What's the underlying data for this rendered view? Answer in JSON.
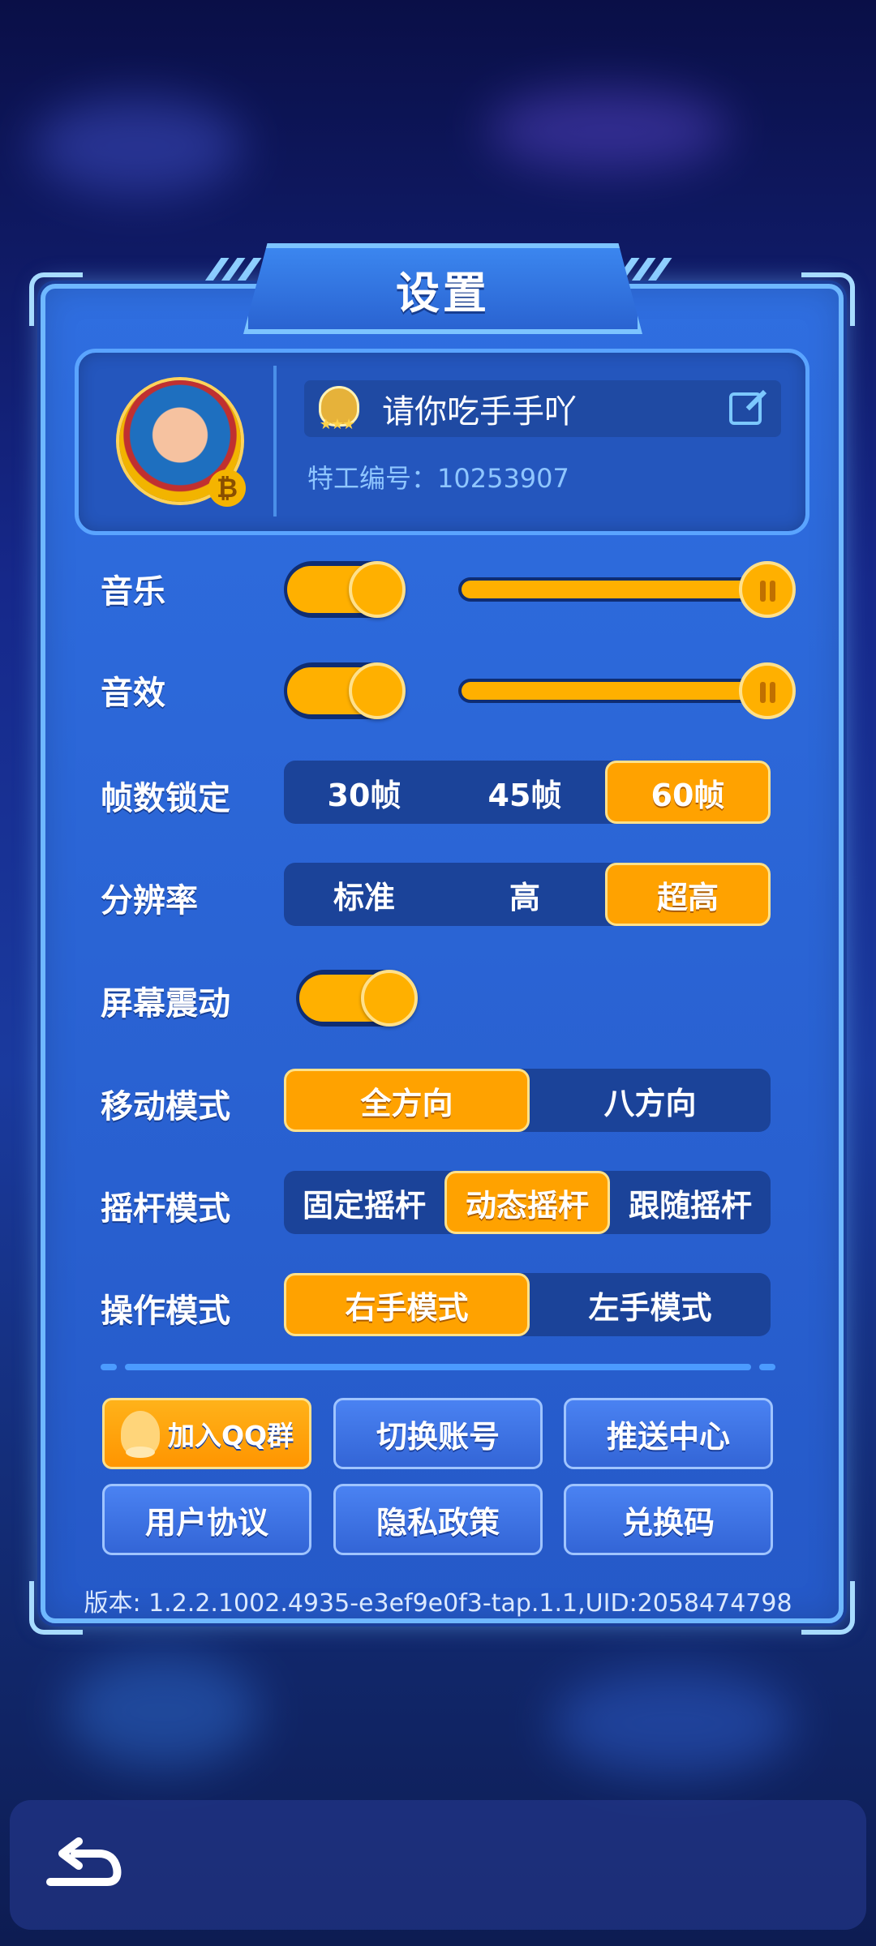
{
  "title": "设置",
  "profile": {
    "name": "请你吃手手吖",
    "agent_id": "特工编号：10253907"
  },
  "settings": {
    "music": {
      "label": "音乐",
      "enabled": true,
      "level": 1.0
    },
    "sfx": {
      "label": "音效",
      "enabled": true,
      "level": 1.0
    },
    "fps": {
      "label": "帧数锁定",
      "options": [
        "30帧",
        "45帧",
        "60帧"
      ],
      "selected": 2
    },
    "resolution": {
      "label": "分辨率",
      "options": [
        "标准",
        "高",
        "超高"
      ],
      "selected": 2
    },
    "shake": {
      "label": "屏幕震动",
      "enabled": true
    },
    "move_mode": {
      "label": "移动模式",
      "options": [
        "全方向",
        "八方向"
      ],
      "selected": 0
    },
    "joystick_mode": {
      "label": "摇杆模式",
      "options": [
        "固定摇杆",
        "动态摇杆",
        "跟随摇杆"
      ],
      "selected": 1
    },
    "hand_mode": {
      "label": "操作模式",
      "options": [
        "右手模式",
        "左手模式"
      ],
      "selected": 0
    }
  },
  "buttons": {
    "join_qq": "加入QQ群",
    "switch_account": "切换账号",
    "push_center": "推送中心",
    "user_agreement": "用户协议",
    "privacy_policy": "隐私政策",
    "redeem_code": "兑换码"
  },
  "version": "版本: 1.2.2.1002.4935-e3ef9e0f3-tap.1.1,UID:2058474798",
  "colors": {
    "accent": "#ffa200",
    "panel": "#2f6ee0",
    "border": "#6fb8ff"
  }
}
